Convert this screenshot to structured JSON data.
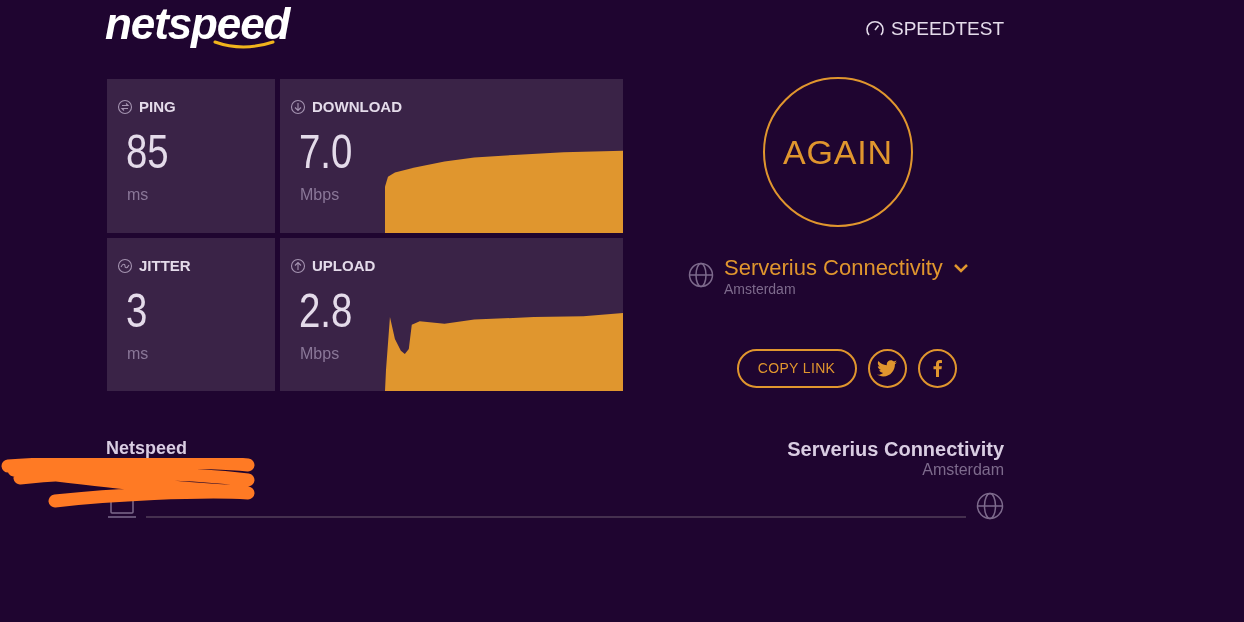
{
  "header": {
    "logo": "netspeed",
    "nav_link": "SPEEDTEST"
  },
  "results": [
    {
      "kind": "ping",
      "label": "PING",
      "value": "85",
      "unit": "ms"
    },
    {
      "kind": "download",
      "label": "DOWNLOAD",
      "value": "7.0",
      "unit": "Mbps"
    },
    {
      "kind": "jitter",
      "label": "JITTER",
      "value": "3",
      "unit": "ms"
    },
    {
      "kind": "upload",
      "label": "UPLOAD",
      "value": "2.8",
      "unit": "Mbps"
    }
  ],
  "again_button": "AGAIN",
  "server": {
    "name": "Serverius Connectivity",
    "location": "Amsterdam"
  },
  "share": {
    "copy_link": "COPY LINK"
  },
  "connection": {
    "client": "Netspeed",
    "server_name": "Serverius Connectivity",
    "server_location": "Amsterdam"
  }
}
